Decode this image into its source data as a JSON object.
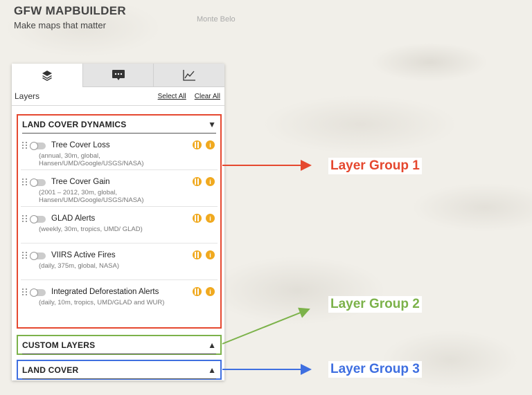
{
  "brand": {
    "title": "GFW MAPBUILDER",
    "subtitle": "Make maps that matter"
  },
  "map": {
    "place_label": "Monte Belo"
  },
  "panel": {
    "tabs": [
      {
        "icon": "layers-icon",
        "active": true
      },
      {
        "icon": "chat-icon",
        "active": false
      },
      {
        "icon": "chart-icon",
        "active": false
      }
    ],
    "header": {
      "title": "Layers",
      "select_all": "Select All",
      "clear_all": "Clear All"
    },
    "groups": [
      {
        "title": "LAND COVER DYNAMICS",
        "arrow": "▼",
        "layers": [
          {
            "name": "Tree Cover Loss",
            "meta": "(annual, 30m, global, Hansen/UMD/Google/USGS/NASA)"
          },
          {
            "name": "Tree Cover Gain",
            "meta": "(2001 – 2012, 30m, global, Hansen/UMD/Google/USGS/NASA)"
          },
          {
            "name": "GLAD Alerts",
            "meta": "(weekly, 30m, tropics, UMD/ GLAD)"
          },
          {
            "name": "VIIRS Active Fires",
            "meta": "(daily, 375m, global, NASA)"
          },
          {
            "name": "Integrated Deforestation Alerts",
            "meta": "(daily, 10m, tropics, UMD/GLAD and WUR)"
          }
        ]
      },
      {
        "title": "CUSTOM LAYERS",
        "arrow": "▲"
      },
      {
        "title": "LAND COVER",
        "arrow": "▲"
      }
    ]
  },
  "callouts": {
    "group1": "Layer Group 1",
    "group2": "Layer Group 2",
    "group3": "Layer Group 3"
  },
  "colors": {
    "group1": "#e5482f",
    "group2": "#7cb24a",
    "group3": "#3f6fe0",
    "accent": "#f0a91f"
  }
}
